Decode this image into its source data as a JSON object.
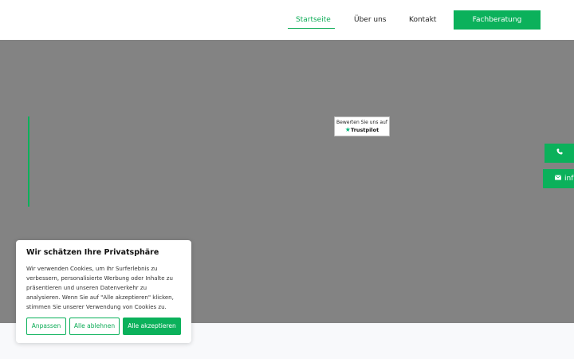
{
  "nav": {
    "items": [
      {
        "label": "Startseite",
        "active": true
      },
      {
        "label": "Über uns",
        "active": false
      },
      {
        "label": "Kontakt",
        "active": false
      }
    ],
    "cta_label": "Fachberatung"
  },
  "trustpilot": {
    "text": "Bewerten Sie uns auf",
    "logo": "Trustpilot"
  },
  "side_buttons": {
    "phone_icon": "phone-icon",
    "mail_icon": "mail-icon",
    "mail_label": "inf"
  },
  "cookie": {
    "title": "Wir schätzen Ihre Privatsphäre",
    "text": "Wir verwenden Cookies, um Ihr Surferlebnis zu verbessern, personalisierte Werbung oder Inhalte zu präsentieren und unseren Datenverkehr zu analysieren. Wenn Sie auf \"Alle akzeptieren\" klicken, stimmen Sie unserer Verwendung von Cookies zu.",
    "customize_label": "Anpassen",
    "reject_label": "Alle ablehnen",
    "accept_label": "Alle akzeptieren"
  },
  "colors": {
    "accent": "#0bb15b",
    "hero_background": "#838383"
  }
}
